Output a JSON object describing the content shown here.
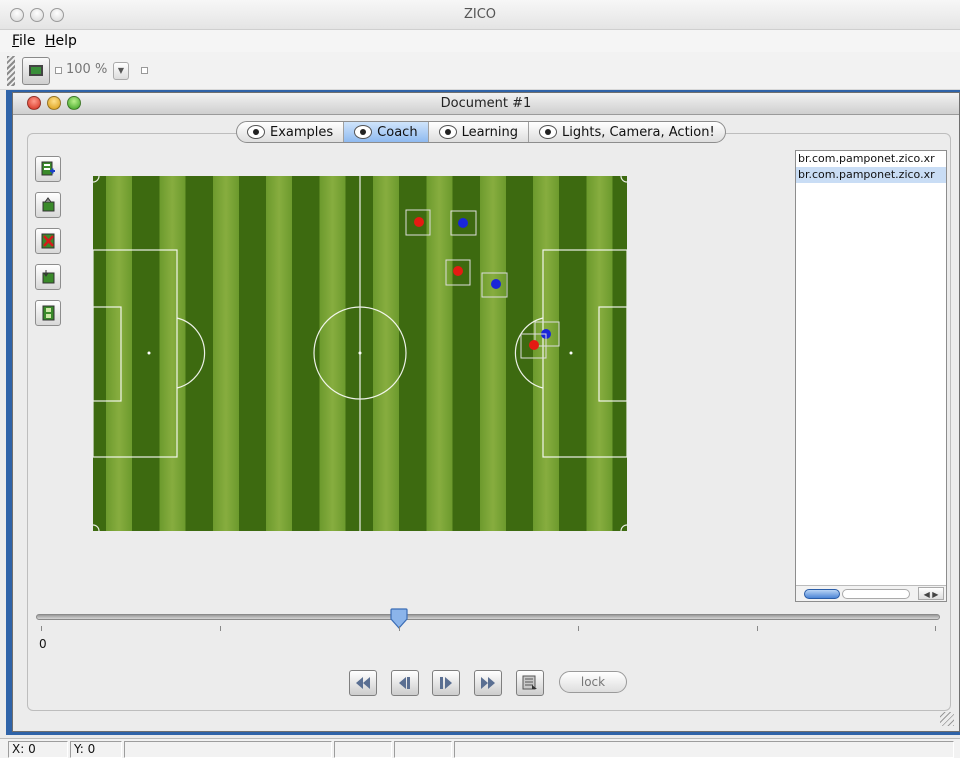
{
  "app": {
    "title": "ZICO"
  },
  "menu": [
    {
      "underline": "F",
      "rest": "ile"
    },
    {
      "underline": "H",
      "rest": "elp"
    }
  ],
  "toolbar": {
    "zoom": "100 %"
  },
  "document": {
    "title": "Document #1",
    "tabs": [
      {
        "label": "Examples",
        "selected": false
      },
      {
        "label": "Coach",
        "selected": true
      },
      {
        "label": "Learning",
        "selected": false
      },
      {
        "label": "Lights, Camera, Action!",
        "selected": false
      }
    ],
    "tools": [
      {
        "icon": "add-document-icon"
      },
      {
        "icon": "open-icon"
      },
      {
        "icon": "delete-icon"
      },
      {
        "icon": "save-icon"
      },
      {
        "icon": "film-icon"
      }
    ],
    "file_list": [
      {
        "label": "br.com.pamponet.zico.xr",
        "selected": false
      },
      {
        "label": "br.com.pamponet.zico.xr",
        "selected": true
      }
    ],
    "timeline": {
      "label": "0"
    },
    "playback": {
      "buttons": [
        "rewind-icon",
        "step-back-icon",
        "step-forward-icon",
        "fast-forward-icon",
        "record-icon"
      ],
      "lock_label": "lock"
    },
    "players": {
      "team_red": "#e51b13",
      "team_blue": "#1a26d9"
    }
  },
  "status": {
    "x": "X: 0",
    "y": "Y: 0"
  }
}
